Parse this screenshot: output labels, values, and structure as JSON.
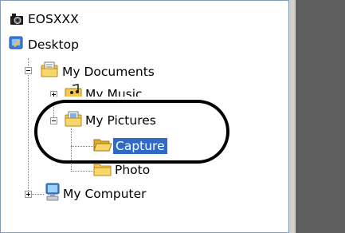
{
  "tree": {
    "items": [
      {
        "label": "EOSXXX",
        "icon": "camera-icon"
      },
      {
        "label": "Desktop",
        "icon": "desktop-icon"
      },
      {
        "label": "My Documents",
        "icon": "documents-folder-icon",
        "expander": "minus"
      },
      {
        "label": "My Music",
        "icon": "music-folder-icon",
        "expander": "plus"
      },
      {
        "label": "My Pictures",
        "icon": "pictures-folder-icon",
        "expander": "minus"
      },
      {
        "label": "Capture",
        "icon": "folder-open-icon",
        "selected": true
      },
      {
        "label": "Photo",
        "icon": "folder-icon"
      },
      {
        "label": "My Computer",
        "icon": "computer-icon",
        "expander": "plus"
      }
    ]
  },
  "colors": {
    "selection": "#316ac5",
    "folder": "#f5c84a",
    "panel_dark": "#5f5f5f"
  }
}
